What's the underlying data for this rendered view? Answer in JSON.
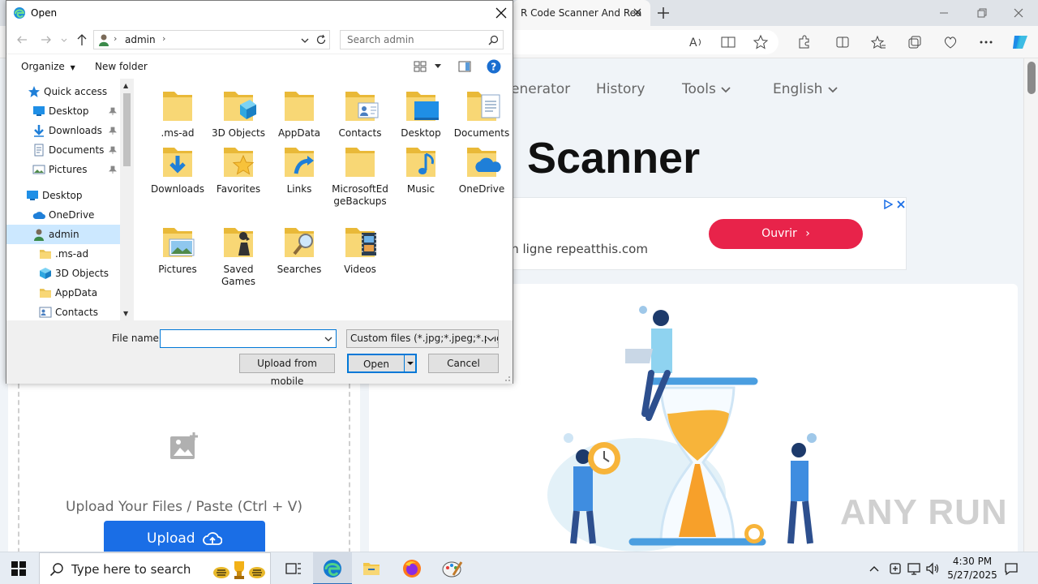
{
  "browser": {
    "tab_title": "R Code Scanner And Read",
    "nav_items": [
      "enerator",
      "History",
      "Tools",
      "English"
    ],
    "hero_title": "Scanner",
    "ad": {
      "text": "en ligne repeatthis.com",
      "button": "Ouvrir"
    },
    "upload_text": "Upload Your Files / Paste (Ctrl + V)",
    "upload_button": "Upload",
    "watermark": "ANY RUN"
  },
  "dialog": {
    "title": "Open",
    "path": "admin",
    "search_placeholder": "Search admin",
    "toolbar": {
      "organize": "Organize",
      "new_folder": "New folder"
    },
    "nav_pane": {
      "items": [
        {
          "label": "Quick access",
          "icon": "star-icon"
        },
        {
          "label": "Desktop",
          "icon": "desktop-icon",
          "pinned": true
        },
        {
          "label": "Downloads",
          "icon": "downloads-icon",
          "pinned": true
        },
        {
          "label": "Documents",
          "icon": "documents-icon",
          "pinned": true
        },
        {
          "label": "Pictures",
          "icon": "pictures-icon",
          "pinned": true
        },
        {
          "label": "Desktop",
          "icon": "desktop-icon"
        },
        {
          "label": "OneDrive",
          "icon": "cloud-icon"
        },
        {
          "label": "admin",
          "icon": "user-icon",
          "selected": true
        },
        {
          "label": ".ms-ad",
          "icon": "folder-icon"
        },
        {
          "label": "3D Objects",
          "icon": "cube-icon"
        },
        {
          "label": "AppData",
          "icon": "folder-icon"
        },
        {
          "label": "Contacts",
          "icon": "contacts-icon"
        }
      ]
    },
    "files": [
      {
        "name": ".ms-ad",
        "icon": "folder-icon"
      },
      {
        "name": "3D Objects",
        "icon": "cube-icon"
      },
      {
        "name": "AppData",
        "icon": "folder-icon"
      },
      {
        "name": "Contacts",
        "icon": "contacts-icon"
      },
      {
        "name": "Desktop",
        "icon": "desktop-icon"
      },
      {
        "name": "Documents",
        "icon": "documents-icon"
      },
      {
        "name": "Downloads",
        "icon": "downloads-icon"
      },
      {
        "name": "Favorites",
        "icon": "star-icon"
      },
      {
        "name": "Links",
        "icon": "link-icon"
      },
      {
        "name": "MicrosoftEdgeBackups",
        "icon": "folder-icon"
      },
      {
        "name": "Music",
        "icon": "music-icon"
      },
      {
        "name": "OneDrive",
        "icon": "cloud-icon"
      },
      {
        "name": "Pictures",
        "icon": "pictures-icon"
      },
      {
        "name": "Saved Games",
        "icon": "chess-icon"
      },
      {
        "name": "Searches",
        "icon": "magnifier-icon"
      },
      {
        "name": "Videos",
        "icon": "film-icon"
      }
    ],
    "file_name_label": "File name:",
    "file_name_value": "",
    "file_type": "Custom files (*.jpg;*.jpeg;*.png",
    "upload_mobile": "Upload from mobile",
    "open": "Open",
    "cancel": "Cancel"
  },
  "taskbar": {
    "search_placeholder": "Type here to search",
    "time": "4:30 PM",
    "date": "5/27/2025"
  },
  "colors": {
    "accent": "#0078d7",
    "upload": "#1a6ee6",
    "ad_button": "#e8234a",
    "folder": "#f8d775"
  }
}
